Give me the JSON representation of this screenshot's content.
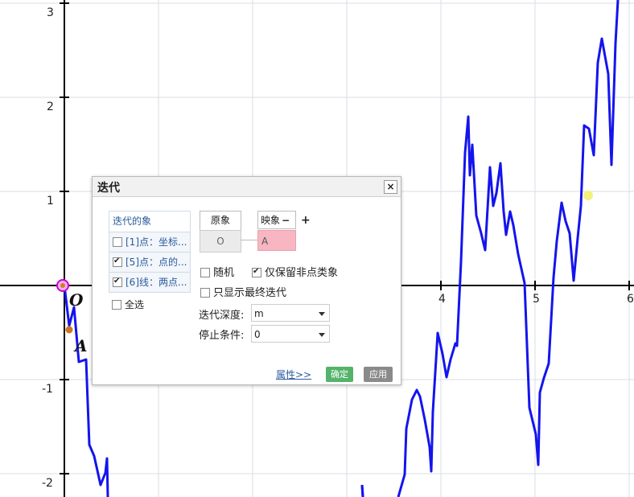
{
  "graph": {
    "x_ticks": [
      "4",
      "5",
      "6"
    ],
    "y_ticks": [
      "3",
      "2",
      "1",
      "-1",
      "-2"
    ],
    "point_labels": {
      "origin": "O",
      "point_a": "A"
    },
    "colors": {
      "curve": "#1414ee",
      "axis": "#000000",
      "grid": "#d9dde3",
      "origin_point": "#cc00cc",
      "point_a": "#cc7722",
      "highlight_dot": "#f2f27a"
    }
  },
  "dialog": {
    "title": "迭代",
    "close_icon": "×",
    "list_header": "迭代的象",
    "items": [
      {
        "label": "[1]点：坐标...",
        "checked": false
      },
      {
        "label": "[5]点：点的...",
        "checked": true
      },
      {
        "label": "[6]线：两点...",
        "checked": true
      }
    ],
    "select_all": "全选",
    "preimage_header": "原象",
    "image_header": "映象",
    "minus_icon": "−",
    "plus_icon": "+",
    "preimage_value": "O",
    "image_value": "A",
    "options": {
      "random": {
        "label": "随机",
        "checked": false
      },
      "keep_non_point": {
        "label": "仅保留非点类象",
        "checked": true
      },
      "final_only": {
        "label": "只显示最终迭代",
        "checked": false
      }
    },
    "depth_label": "迭代深度:",
    "depth_value": "m",
    "stop_label": "停止条件:",
    "stop_value": "0",
    "properties_link": "属性>>",
    "confirm_button": "确定",
    "apply_button": "应用",
    "colors": {
      "confirm": "#53b36a",
      "apply": "#8a8a8a",
      "image_cell": "#f7b6c2",
      "preimage_cell": "#ebebeb"
    }
  }
}
